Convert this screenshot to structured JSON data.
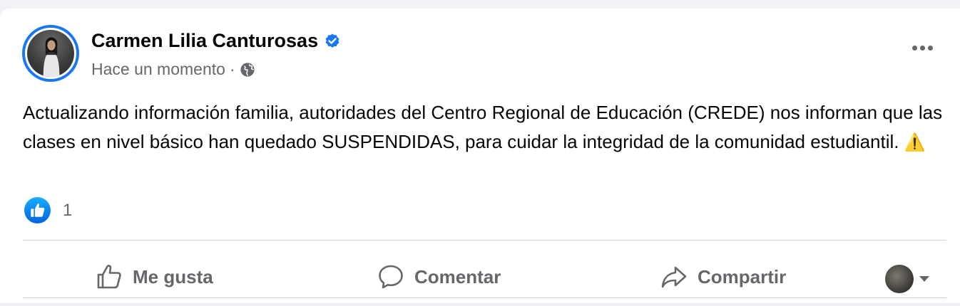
{
  "post": {
    "author": "Carmen Lilia Canturosas",
    "time": "Hace un momento",
    "separator": "·",
    "text": "Actualizando información familia, autoridades del Centro Regional de Educación (CREDE) nos informan que las clases en nivel básico han quedado SUSPENDIDAS, para cuidar la integridad de la comunidad estudiantil.",
    "emoji": "⚠️",
    "verified_icon": "verified-badge-icon",
    "audience_icon": "globe-icon"
  },
  "reactions": {
    "icon": "like-badge-icon",
    "count": "1"
  },
  "actions": {
    "like_label": "Me gusta",
    "comment_label": "Comentar",
    "share_label": "Compartir"
  },
  "colors": {
    "accent": "#1877f2",
    "muted_text": "#65676b",
    "page_bg": "#f0f2f5"
  }
}
